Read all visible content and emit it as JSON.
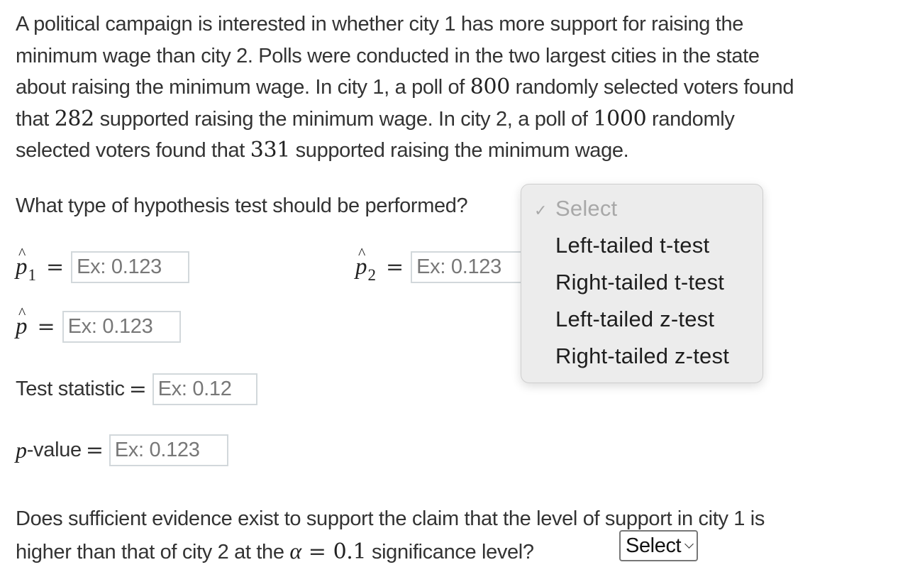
{
  "problem": {
    "line1": "A political campaign is interested in whether city 1 has more support for raising the",
    "line2": "minimum wage than city 2. Polls were conducted in the two largest cities in the state",
    "line3_a": "about raising the minimum wage. In city 1, a poll of ",
    "n1": "800",
    "line3_b": " randomly selected voters found",
    "line4_a": "that ",
    "x1": "282",
    "line4_b": " supported raising the minimum wage. In city 2, a poll of ",
    "n2": "1000",
    "line4_c": " randomly",
    "line5_a": "selected voters found that ",
    "x2": "331",
    "line5_b": " supported raising the minimum wage."
  },
  "test_type": {
    "question": "What type of hypothesis test should be performed?",
    "selected": "Select",
    "options": [
      "Select",
      "Left-tailed t-test",
      "Right-tailed t-test",
      "Left-tailed z-test",
      "Right-tailed z-test"
    ]
  },
  "fields": {
    "p1_hat": {
      "symbol": "p",
      "subscript": "1",
      "placeholder": "Ex: 0.123",
      "value": ""
    },
    "p2_hat": {
      "symbol": "p",
      "subscript": "2",
      "placeholder": "Ex: 0.123",
      "value": ""
    },
    "p_hat": {
      "symbol": "p",
      "placeholder": "Ex: 0.123",
      "value": ""
    },
    "test_statistic": {
      "label": "Test statistic",
      "placeholder": "Ex: 0.12",
      "value": ""
    },
    "p_value": {
      "label_italic": "p",
      "label_rest": "-value",
      "placeholder": "Ex: 0.123",
      "value": ""
    }
  },
  "conclusion": {
    "line1": "Does sufficient evidence exist to support the claim that the level of support in city 1 is",
    "line2_a": "higher than that of city 2 at the ",
    "alpha_symbol": "α",
    "equals": "=",
    "alpha_value": "0.1",
    "line2_b": " significance level?",
    "select_label": "Select"
  },
  "symbols": {
    "hat": "^",
    "equals": "=",
    "check": "✓"
  }
}
